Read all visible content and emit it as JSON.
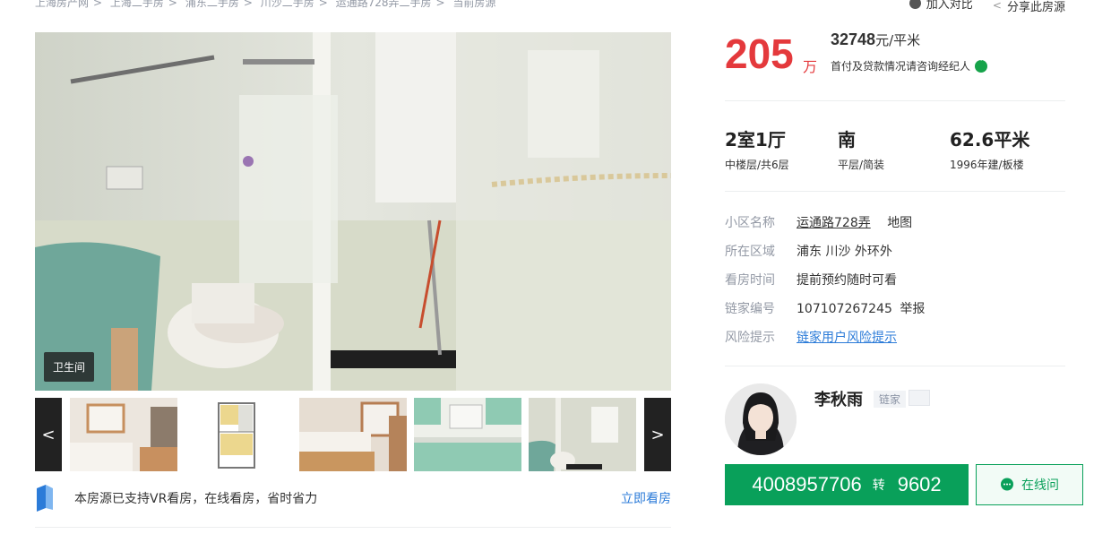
{
  "breadcrumb": [
    "上海房产网",
    "上海二手房",
    "浦东二手房",
    "川沙二手房",
    "运通路728弄二手房",
    "当前房源"
  ],
  "top_actions": {
    "compare": "加入对比",
    "share": "分享此房源"
  },
  "photo": {
    "label": "卫生间"
  },
  "thumbs": {
    "prev": "<",
    "next": ">"
  },
  "vr": {
    "text": "本房源已支持VR看房，在线看房，省时省力",
    "link": "立即看房"
  },
  "price": {
    "total": "205",
    "total_unit": "万",
    "per_value": "32748",
    "per_unit": "元/平米",
    "loan_tip": "首付及贷款情况请咨询经纪人"
  },
  "specs": [
    {
      "main": "2室1厅",
      "sub": "中楼层/共6层"
    },
    {
      "main": "南",
      "sub": "平层/简装"
    },
    {
      "main": "62.6平米",
      "sub": "1996年建/板楼"
    }
  ],
  "info": {
    "community_key": "小区名称",
    "community_value": "运通路728弄",
    "map": "地图",
    "area_key": "所在区域",
    "area_value": "浦东 川沙 外环外",
    "visit_key": "看房时间",
    "visit_value": "提前预约随时可看",
    "id_key": "链家编号",
    "id_value": "107107267245",
    "report": "举报",
    "risk_key": "风险提示",
    "risk_value": "链家用户风险提示"
  },
  "agent": {
    "name": "李秋雨",
    "tag": "链家",
    "phone": "4008957706",
    "phone_sep": "转",
    "ext": "9602",
    "online": "在线问"
  },
  "colors": {
    "price_red": "#e4393c",
    "brand_green": "#09a05a",
    "link_blue": "#2b7bd8"
  }
}
